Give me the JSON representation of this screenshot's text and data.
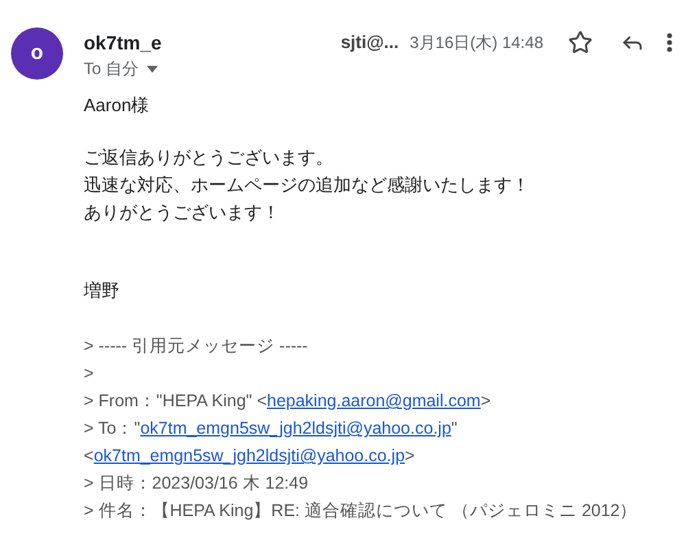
{
  "sender": {
    "avatar_letter": "o",
    "name": "ok7tm_e",
    "address": "sjti@...",
    "date": "3月16日(木) 14:48",
    "recipient": "To 自分"
  },
  "paragraphs": [
    [
      "Aaron様"
    ],
    [
      "ご返信ありがとうございます。",
      "迅速な対応、ホームページの追加など感謝いたします！",
      "ありがとうございます！"
    ],
    [
      "増野"
    ]
  ],
  "quote": [
    [
      {
        "text": "> ----- 引用元メッセージ -----"
      }
    ],
    [
      {
        "text": ">"
      }
    ],
    [
      {
        "text": "> From：\"HEPA King\" <"
      },
      {
        "text": "hepaking.aaron@gmail.com",
        "link": true
      },
      {
        "text": ">"
      }
    ],
    [
      {
        "text": "> To：\""
      },
      {
        "text": "ok7tm_emgn5sw_jgh2ldsjti@yahoo.co.jp",
        "link": true
      },
      {
        "text": "\""
      }
    ],
    [
      {
        "text": "<"
      },
      {
        "text": "ok7tm_emgn5sw_jgh2ldsjti@yahoo.co.jp",
        "link": true
      },
      {
        "text": ">"
      }
    ],
    [
      {
        "text": "> 日時：2023/03/16 木 12:49"
      }
    ],
    [
      {
        "text": "> 件名：【HEPA King】RE: 適合確認について （パジェロミニ 2012）"
      }
    ]
  ]
}
